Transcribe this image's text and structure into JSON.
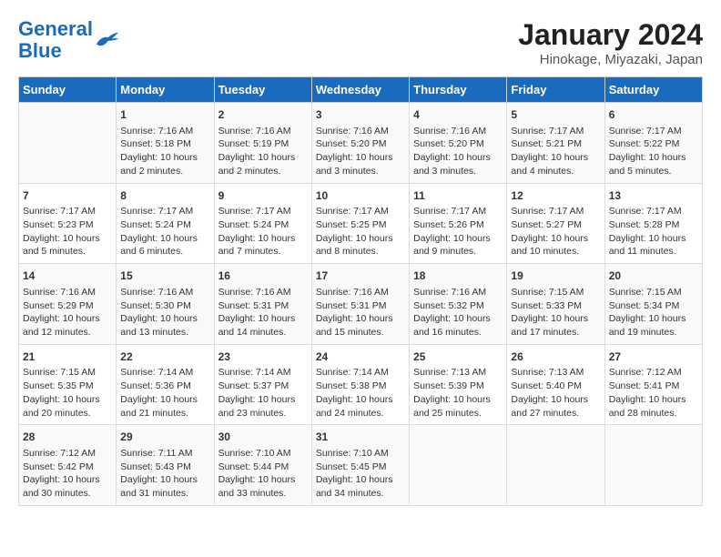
{
  "header": {
    "logo_line1": "General",
    "logo_line2": "Blue",
    "title": "January 2024",
    "subtitle": "Hinokage, Miyazaki, Japan"
  },
  "weekdays": [
    "Sunday",
    "Monday",
    "Tuesday",
    "Wednesday",
    "Thursday",
    "Friday",
    "Saturday"
  ],
  "weeks": [
    [
      {
        "day": "",
        "info": ""
      },
      {
        "day": "1",
        "info": "Sunrise: 7:16 AM\nSunset: 5:18 PM\nDaylight: 10 hours\nand 2 minutes."
      },
      {
        "day": "2",
        "info": "Sunrise: 7:16 AM\nSunset: 5:19 PM\nDaylight: 10 hours\nand 2 minutes."
      },
      {
        "day": "3",
        "info": "Sunrise: 7:16 AM\nSunset: 5:20 PM\nDaylight: 10 hours\nand 3 minutes."
      },
      {
        "day": "4",
        "info": "Sunrise: 7:16 AM\nSunset: 5:20 PM\nDaylight: 10 hours\nand 3 minutes."
      },
      {
        "day": "5",
        "info": "Sunrise: 7:17 AM\nSunset: 5:21 PM\nDaylight: 10 hours\nand 4 minutes."
      },
      {
        "day": "6",
        "info": "Sunrise: 7:17 AM\nSunset: 5:22 PM\nDaylight: 10 hours\nand 5 minutes."
      }
    ],
    [
      {
        "day": "7",
        "info": "Sunrise: 7:17 AM\nSunset: 5:23 PM\nDaylight: 10 hours\nand 5 minutes."
      },
      {
        "day": "8",
        "info": "Sunrise: 7:17 AM\nSunset: 5:24 PM\nDaylight: 10 hours\nand 6 minutes."
      },
      {
        "day": "9",
        "info": "Sunrise: 7:17 AM\nSunset: 5:24 PM\nDaylight: 10 hours\nand 7 minutes."
      },
      {
        "day": "10",
        "info": "Sunrise: 7:17 AM\nSunset: 5:25 PM\nDaylight: 10 hours\nand 8 minutes."
      },
      {
        "day": "11",
        "info": "Sunrise: 7:17 AM\nSunset: 5:26 PM\nDaylight: 10 hours\nand 9 minutes."
      },
      {
        "day": "12",
        "info": "Sunrise: 7:17 AM\nSunset: 5:27 PM\nDaylight: 10 hours\nand 10 minutes."
      },
      {
        "day": "13",
        "info": "Sunrise: 7:17 AM\nSunset: 5:28 PM\nDaylight: 10 hours\nand 11 minutes."
      }
    ],
    [
      {
        "day": "14",
        "info": "Sunrise: 7:16 AM\nSunset: 5:29 PM\nDaylight: 10 hours\nand 12 minutes."
      },
      {
        "day": "15",
        "info": "Sunrise: 7:16 AM\nSunset: 5:30 PM\nDaylight: 10 hours\nand 13 minutes."
      },
      {
        "day": "16",
        "info": "Sunrise: 7:16 AM\nSunset: 5:31 PM\nDaylight: 10 hours\nand 14 minutes."
      },
      {
        "day": "17",
        "info": "Sunrise: 7:16 AM\nSunset: 5:31 PM\nDaylight: 10 hours\nand 15 minutes."
      },
      {
        "day": "18",
        "info": "Sunrise: 7:16 AM\nSunset: 5:32 PM\nDaylight: 10 hours\nand 16 minutes."
      },
      {
        "day": "19",
        "info": "Sunrise: 7:15 AM\nSunset: 5:33 PM\nDaylight: 10 hours\nand 17 minutes."
      },
      {
        "day": "20",
        "info": "Sunrise: 7:15 AM\nSunset: 5:34 PM\nDaylight: 10 hours\nand 19 minutes."
      }
    ],
    [
      {
        "day": "21",
        "info": "Sunrise: 7:15 AM\nSunset: 5:35 PM\nDaylight: 10 hours\nand 20 minutes."
      },
      {
        "day": "22",
        "info": "Sunrise: 7:14 AM\nSunset: 5:36 PM\nDaylight: 10 hours\nand 21 minutes."
      },
      {
        "day": "23",
        "info": "Sunrise: 7:14 AM\nSunset: 5:37 PM\nDaylight: 10 hours\nand 23 minutes."
      },
      {
        "day": "24",
        "info": "Sunrise: 7:14 AM\nSunset: 5:38 PM\nDaylight: 10 hours\nand 24 minutes."
      },
      {
        "day": "25",
        "info": "Sunrise: 7:13 AM\nSunset: 5:39 PM\nDaylight: 10 hours\nand 25 minutes."
      },
      {
        "day": "26",
        "info": "Sunrise: 7:13 AM\nSunset: 5:40 PM\nDaylight: 10 hours\nand 27 minutes."
      },
      {
        "day": "27",
        "info": "Sunrise: 7:12 AM\nSunset: 5:41 PM\nDaylight: 10 hours\nand 28 minutes."
      }
    ],
    [
      {
        "day": "28",
        "info": "Sunrise: 7:12 AM\nSunset: 5:42 PM\nDaylight: 10 hours\nand 30 minutes."
      },
      {
        "day": "29",
        "info": "Sunrise: 7:11 AM\nSunset: 5:43 PM\nDaylight: 10 hours\nand 31 minutes."
      },
      {
        "day": "30",
        "info": "Sunrise: 7:10 AM\nSunset: 5:44 PM\nDaylight: 10 hours\nand 33 minutes."
      },
      {
        "day": "31",
        "info": "Sunrise: 7:10 AM\nSunset: 5:45 PM\nDaylight: 10 hours\nand 34 minutes."
      },
      {
        "day": "",
        "info": ""
      },
      {
        "day": "",
        "info": ""
      },
      {
        "day": "",
        "info": ""
      }
    ]
  ]
}
